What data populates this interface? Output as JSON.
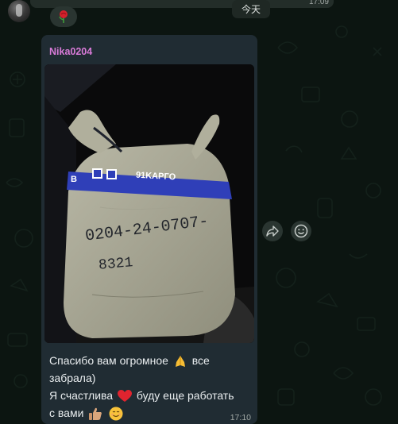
{
  "chat": {
    "date_label": "今天",
    "previous_message": {
      "time": "17:09",
      "reaction": "rose-emoji"
    },
    "message": {
      "sender": "Nika0204",
      "photo": {
        "handwritten_text": [
          "0204-24-0707-",
          "8321"
        ],
        "label_text": "91KAPГO",
        "label_prefix": "B"
      },
      "caption_lines": [
        "Спасибо вам огромное",
        "все",
        "забрала)",
        "Я счастлива",
        "буду еще работать",
        "с вами"
      ],
      "emojis": [
        "folded-hands-emoji",
        "red-heart-emoji",
        "thumbs-up-emoji",
        "smiling-face-emoji"
      ],
      "time": "17:10"
    },
    "actions": [
      "forward-icon",
      "emoji-reaction-icon"
    ]
  },
  "colors": {
    "background": "#0c1511",
    "bubble": "#202c33",
    "sender_name": "#d87bd8",
    "text": "#e9edef",
    "label_blue": "#2f3fb8"
  }
}
